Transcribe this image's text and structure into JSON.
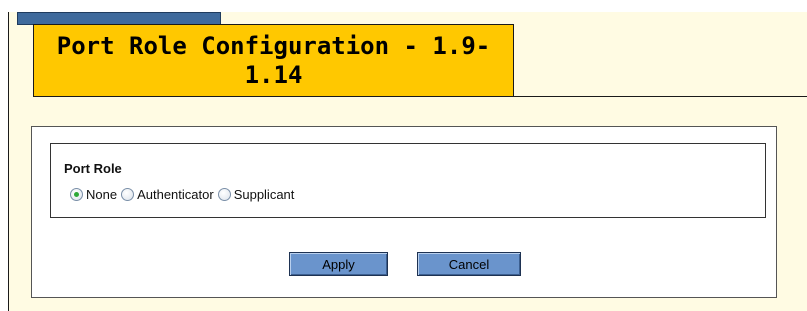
{
  "header": {
    "title": "Port Role Configuration - 1.9-1.14",
    "title_line1": "Port Role Configuration - 1.9-",
    "title_line2": "1.14"
  },
  "port_role": {
    "label": "Port Role",
    "options": [
      {
        "label": "None",
        "selected": true
      },
      {
        "label": "Authenticator",
        "selected": false
      },
      {
        "label": "Supplicant",
        "selected": false
      }
    ]
  },
  "actions": {
    "apply_label": "Apply",
    "cancel_label": "Cancel"
  },
  "colors": {
    "title_bg": "#ffc800",
    "page_bg": "#fffbe3",
    "tab_strip": "#3f6a9c",
    "button_bg": "#6a94cc",
    "radio_selected": "#2ea838"
  }
}
